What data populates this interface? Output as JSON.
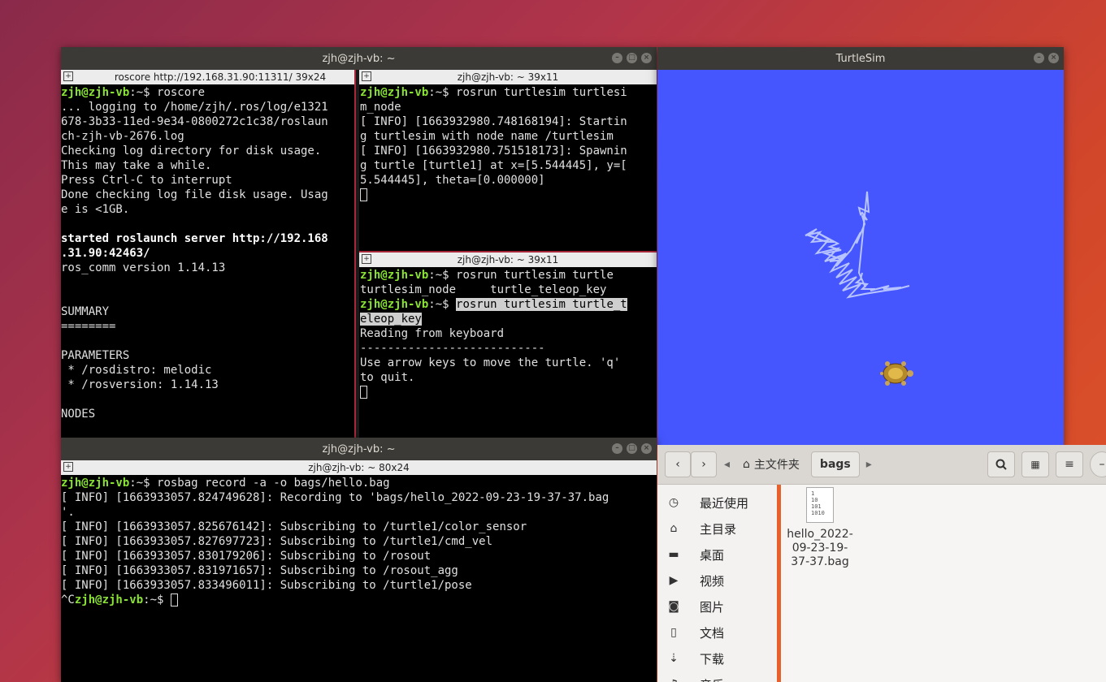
{
  "colors": {
    "prompt": "#8ae234",
    "turtlesim_bg": "#4556ff",
    "titlebar": "#3b3a36",
    "accent": "#e8602c"
  },
  "main_terminal": {
    "title": "zjh@zjh-vb: ~",
    "pane_left": {
      "tab": "roscore http://192.168.31.90:11311/ 39x24",
      "lines": [
        {
          "prompt": "zjh@zjh-vb",
          "rest": ":~$ roscore"
        },
        {
          "text": "... logging to /home/zjh/.ros/log/e1321"
        },
        {
          "text": "678-3b33-11ed-9e34-0800272c1c38/roslaun"
        },
        {
          "text": "ch-zjh-vb-2676.log"
        },
        {
          "text": "Checking log directory for disk usage."
        },
        {
          "text": "This may take a while."
        },
        {
          "text": "Press Ctrl-C to interrupt"
        },
        {
          "text": "Done checking log file disk usage. Usag"
        },
        {
          "text": "e is <1GB."
        },
        {
          "text": ""
        },
        {
          "bold": "started roslaunch server http://192.168"
        },
        {
          "bold": ".31.90:42463/"
        },
        {
          "text": "ros_comm version 1.14.13"
        },
        {
          "text": ""
        },
        {
          "text": ""
        },
        {
          "text": "SUMMARY"
        },
        {
          "text": "========"
        },
        {
          "text": ""
        },
        {
          "text": "PARAMETERS"
        },
        {
          "text": " * /rosdistro: melodic"
        },
        {
          "text": " * /rosversion: 1.14.13"
        },
        {
          "text": ""
        },
        {
          "text": "NODES"
        }
      ]
    },
    "pane_top_right": {
      "tab": "zjh@zjh-vb: ~ 39x11",
      "lines": [
        {
          "prompt": "zjh@zjh-vb",
          "rest": ":~$ rosrun turtlesim turtlesi"
        },
        {
          "text": "m_node"
        },
        {
          "text": "[ INFO] [1663932980.748168194]: Startin"
        },
        {
          "text": "g turtlesim with node name /turtlesim"
        },
        {
          "text": "[ INFO] [1663932980.751518173]: Spawnin"
        },
        {
          "text": "g turtle [turtle1] at x=[5.544445], y=["
        },
        {
          "text": "5.544445], theta=[0.000000]"
        }
      ]
    },
    "pane_bottom_right": {
      "tab": "zjh@zjh-vb: ~ 39x11",
      "lines": [
        {
          "prompt": "zjh@zjh-vb",
          "rest": ":~$ rosrun turtlesim turtle"
        },
        {
          "text": "turtlesim_node     turtle_teleop_key"
        },
        {
          "prompt": "zjh@zjh-vb",
          "rest": ":~$ ",
          "sel": "rosrun turtlesim turtle_t"
        },
        {
          "sel_only": "eleop_key"
        },
        {
          "text": "Reading from keyboard"
        },
        {
          "text": "---------------------------"
        },
        {
          "text": "Use arrow keys to move the turtle. 'q'"
        },
        {
          "text": "to quit."
        }
      ]
    }
  },
  "bottom_terminal": {
    "title": "zjh@zjh-vb: ~",
    "tab": "zjh@zjh-vb: ~ 80x24",
    "lines": [
      {
        "prompt": "zjh@zjh-vb",
        "rest": ":~$ rosbag record -a -o bags/hello.bag"
      },
      {
        "text": "[ INFO] [1663933057.824749628]: Recording to 'bags/hello_2022-09-23-19-37-37.bag"
      },
      {
        "text": "'."
      },
      {
        "text": "[ INFO] [1663933057.825676142]: Subscribing to /turtle1/color_sensor"
      },
      {
        "text": "[ INFO] [1663933057.827697723]: Subscribing to /turtle1/cmd_vel"
      },
      {
        "text": "[ INFO] [1663933057.830179206]: Subscribing to /rosout"
      },
      {
        "text": "[ INFO] [1663933057.831971657]: Subscribing to /rosout_agg"
      },
      {
        "text": "[ INFO] [1663933057.833496011]: Subscribing to /turtle1/pose"
      }
    ],
    "last_prefix": "^C",
    "last_prompt": "zjh@zjh-vb",
    "last_rest": ":~$ "
  },
  "turtlesim": {
    "title": "TurtleSim"
  },
  "file_manager": {
    "home_label": "主文件夹",
    "current_folder": "bags",
    "sidebar": [
      {
        "icon": "clock-icon",
        "glyph": "◷",
        "label": "最近使用"
      },
      {
        "icon": "home-icon",
        "glyph": "⌂",
        "label": "主目录"
      },
      {
        "icon": "folder-icon",
        "glyph": "▬",
        "label": "桌面"
      },
      {
        "icon": "video-icon",
        "glyph": "▶",
        "label": "视频"
      },
      {
        "icon": "camera-icon",
        "glyph": "◙",
        "label": "图片"
      },
      {
        "icon": "document-icon",
        "glyph": "▯",
        "label": "文档"
      },
      {
        "icon": "download-icon",
        "glyph": "⇣",
        "label": "下载"
      },
      {
        "icon": "music-icon",
        "glyph": "♫",
        "label": "音乐"
      }
    ],
    "file": {
      "name": "hello_2022-\n09-23-19-\n37-37.bag",
      "icon_text": "1\n10\n101\n1010"
    }
  }
}
